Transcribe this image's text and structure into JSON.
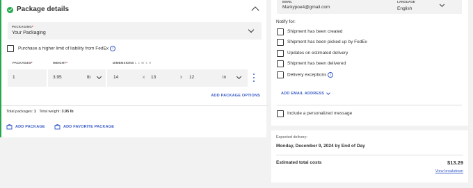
{
  "package": {
    "title": "Package details",
    "packaging_label": "PACKAGING",
    "packaging_value": "Your Packaging",
    "liability_label": "Purchase a higher limit of liability from FedEx",
    "packages_label": "PACKAGES",
    "packages_value": "1",
    "weight_label": "WEIGHT",
    "weight_value": "3.95",
    "weight_unit": "lb",
    "dimensions_label": "DIMENSIONS",
    "dimensions_sub": "L x W x H",
    "length": "14",
    "width": "13",
    "height": "12",
    "dim_unit": "in",
    "times_sign": "x",
    "required_mark": "*",
    "add_package_options": "ADD PACKAGE OPTIONS",
    "total_packages_label": "Total packages:",
    "total_packages_value": "1",
    "total_weight_label": "Total weight:",
    "total_weight_value": "3.95 lb",
    "add_package": "ADD PACKAGE",
    "add_favorite_package": "ADD FAVORITE PACKAGE"
  },
  "notify": {
    "email_label": "EMAIL",
    "email_value": "Markypoe4@gmail.com",
    "language_label": "LANGUAGE",
    "language_value": "English",
    "title": "Notify for:",
    "options": [
      {
        "label": "Shipment has been created"
      },
      {
        "label": "Shipment has been picked up by FedEx"
      },
      {
        "label": "Updates on estimated delivery"
      },
      {
        "label": "Shipment has been delivered"
      },
      {
        "label": "Delivery exceptions"
      }
    ],
    "add_email": "ADD EMAIL ADDRESS",
    "personal_message": "Include a personalized message"
  },
  "summary": {
    "expected_label": "Expected delivery:",
    "expected_value": "Monday, December 9, 2024 by End of Day",
    "estimated_label": "Estimated total costs",
    "estimated_value": "$13.29",
    "view_breakdown": "View breakdown"
  },
  "colors": {
    "accent": "#3a5cc9",
    "success": "#22a84a"
  },
  "icons": {
    "info": "i"
  }
}
